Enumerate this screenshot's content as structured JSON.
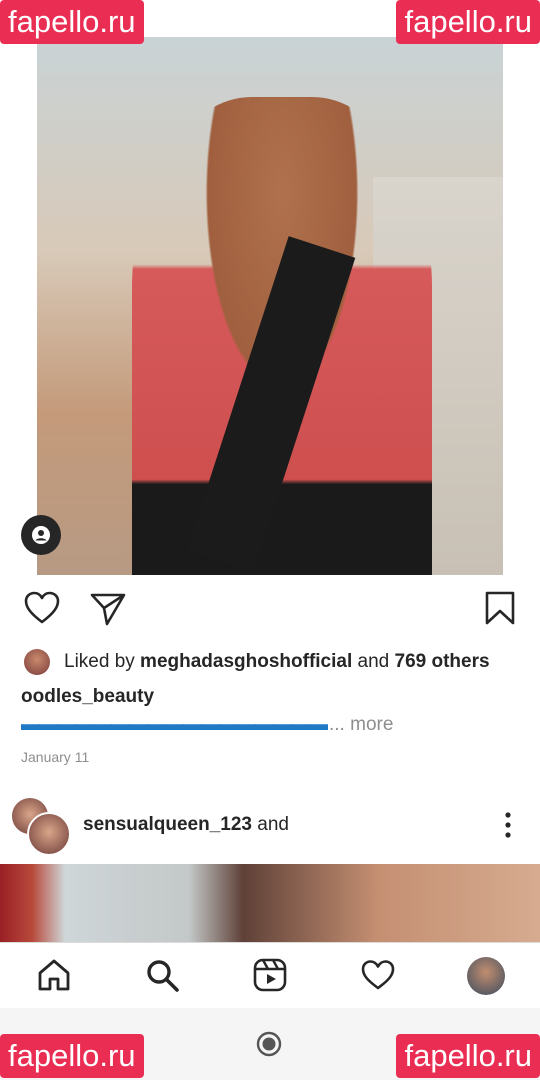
{
  "watermark": {
    "text": "fapello.ru"
  },
  "post": {
    "liked_by_prefix": "Liked by ",
    "liked_by_user": "meghadasghoshofficial",
    "liked_by_and": " and ",
    "liked_by_others": "769 others",
    "username": "oodles_beauty",
    "caption_dashes": "▬▬▬▬▬▬▬▬▬▬▬▬▬▬▬▬▬",
    "caption_more": "... more",
    "date": "January 11"
  },
  "next_post": {
    "username": "sensualqueen_123",
    "suffix": " and"
  },
  "icons": {
    "like": "heart-icon",
    "share": "send-icon",
    "save": "bookmark-icon",
    "tagged": "user-tag-icon",
    "home": "home-icon",
    "search": "search-icon",
    "reels": "reels-icon",
    "activity": "heart-icon",
    "more": "more-vertical-icon"
  },
  "colors": {
    "watermark_bg": "#ea2d53",
    "caption_accent": "#1f79c6",
    "muted_text": "#8e8e8e"
  }
}
